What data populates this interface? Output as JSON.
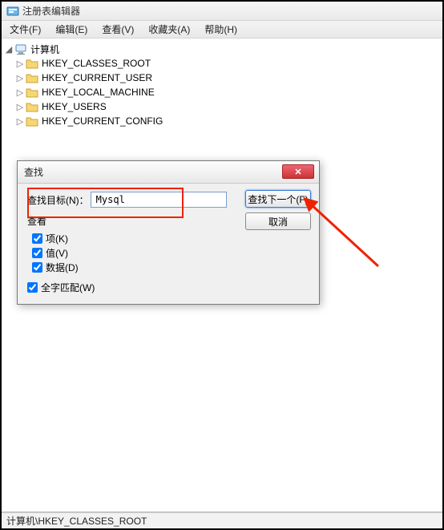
{
  "window": {
    "title": "注册表编辑器"
  },
  "menu": {
    "file": "文件(F)",
    "edit": "编辑(E)",
    "view": "查看(V)",
    "favorites": "收藏夹(A)",
    "help": "帮助(H)"
  },
  "tree": {
    "root": "计算机",
    "keys": [
      "HKEY_CLASSES_ROOT",
      "HKEY_CURRENT_USER",
      "HKEY_LOCAL_MACHINE",
      "HKEY_USERS",
      "HKEY_CURRENT_CONFIG"
    ]
  },
  "status": {
    "path": "计算机\\HKEY_CLASSES_ROOT"
  },
  "dialog": {
    "title": "查找",
    "find_label": "查找目标(N)：",
    "find_value": "Mysql",
    "look_at_title": "查看",
    "chk_keys": "项(K)",
    "chk_values": "值(V)",
    "chk_data": "数据(D)",
    "chk_whole": "全字匹配(W)",
    "btn_find_next": "查找下一个(F)",
    "btn_cancel": "取消",
    "close_x": "✕"
  }
}
